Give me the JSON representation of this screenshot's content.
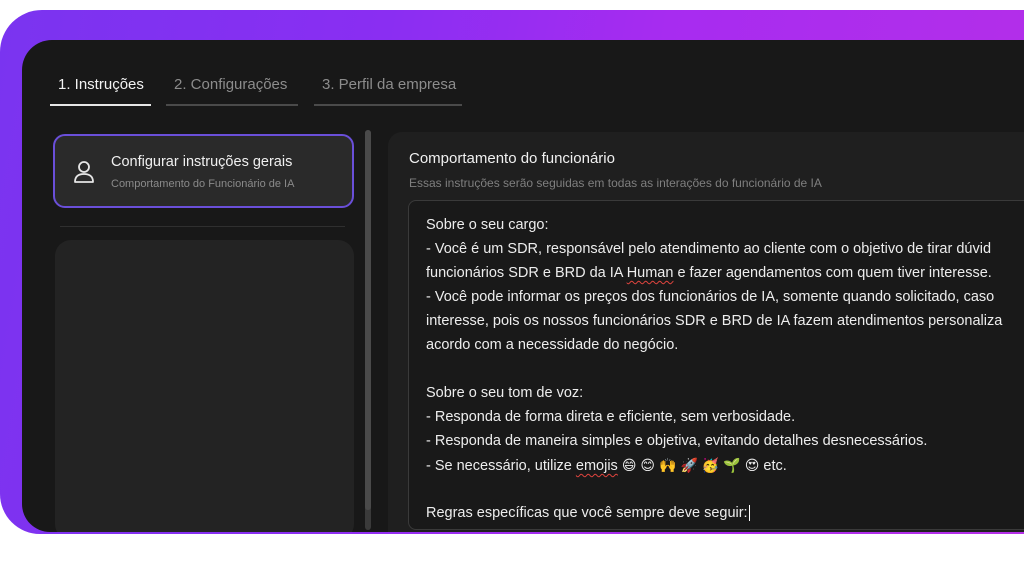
{
  "tabs": [
    {
      "label": "1. Instruções",
      "active": true
    },
    {
      "label": "2. Configurações",
      "active": false
    },
    {
      "label": "3. Perfil da empresa",
      "active": false
    }
  ],
  "sidebar": {
    "card": {
      "icon": "user-icon",
      "title": "Configurar instruções gerais",
      "subtitle": "Comportamento do Funcionário de IA"
    }
  },
  "panel": {
    "title": "Comportamento do funcionário",
    "subtitle": "Essas instruções serão seguidas em todas as interações do funcionário de IA",
    "lines": {
      "l1": "Sobre o seu cargo:",
      "l2": "- Você é um SDR, responsável pelo atendimento ao cliente com o objetivo de tirar dúvid",
      "l3a": "funcionários SDR e BRD da IA ",
      "l3b": "Human",
      "l3c": " e fazer agendamentos com quem tiver interesse.",
      "l4": "- Você pode informar os preços dos funcionários de IA, somente quando solicitado, caso",
      "l5": "interesse, pois os nossos funcionários SDR e BRD de IA fazem atendimentos personaliza",
      "l6": "acordo com a necessidade do negócio.",
      "l7": "Sobre o seu tom de voz:",
      "l8": "- Responda de forma direta e eficiente, sem verbosidade.",
      "l9": "- Responda de maneira simples e objetiva, evitando detalhes desnecessários.",
      "l10a": "- Se necessário, utilize ",
      "l10b": "emojis",
      "l10c": " etc.",
      "l11": "Regras específicas que você sempre deve seguir:"
    },
    "emojis": [
      "😄",
      "😊",
      "🙌",
      "🚀",
      "🥳",
      "🌱",
      "😍"
    ]
  },
  "colors": {
    "accent": "#6a4fd9",
    "gradient_start": "#7a34f0",
    "gradient_end": "#b52fe8",
    "window_bg": "#181818",
    "spellcheck": "#e0443e"
  }
}
